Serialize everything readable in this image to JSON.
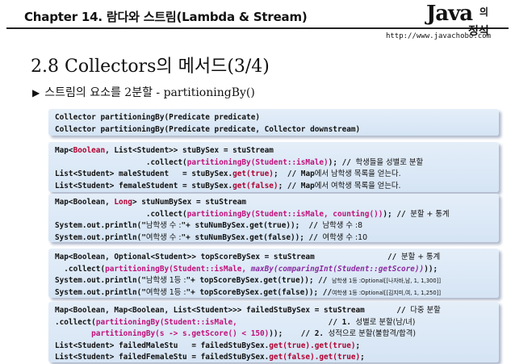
{
  "header": {
    "chapter_title": "Chapter 14. 람다와 스트림(Lambda & Stream)",
    "url": "http://www.javachobo.com",
    "logo_word": "Java",
    "logo_sub1": "의",
    "logo_sub2": "정석"
  },
  "slide": {
    "title": "2.8 Collectors의 메서드(3/4)",
    "bullet": "스트림의 요소를 2분할 - partitioningBy()"
  },
  "code": {
    "b1": {
      "l1": "Collector partitioningBy(Predicate predicate)",
      "l2": "Collector partitioningBy(Predicate predicate, Collector downstream)"
    },
    "b2": {
      "l1a": "Map<",
      "l1b": "Boolean",
      "l1c": ", List<Student>> stuBySex = stuStream",
      "l2a": "                    .collect(",
      "l2b": "partitioningBy(Student::isMale)",
      "l2c": "); // ",
      "l2d": "학생들을 성별로 분할",
      "l3a": "List<Student> maleStudent   = stuBySex.",
      "l3b": "get(true)",
      "l3c": ";  // Map",
      "l3d": "에서 남학생 목록을 얻는다.",
      "l4a": "List<Student> femaleStudent = stuBySex.",
      "l4b": "get(false)",
      "l4c": "; // Map",
      "l4d": "에서 여학생 목록을 얻는다."
    },
    "b3": {
      "l1a": "Map<Boolean, ",
      "l1b": "Long",
      "l1c": "> stuNumBySex = stuStream",
      "l2a": "                    .collect(",
      "l2b": "partitioningBy(Student::isMale, counting())",
      "l2c": "); // ",
      "l2d": "분할 + 통계",
      "l3a": "System.out.println(\"",
      "l3b": "남학생 수 :",
      "l3c": "\"+ stuNumBySex.get(true));  // ",
      "l3d": "남학생 수 :8",
      "l4a": "System.out.println(\"",
      "l4b": "여학생 수 :",
      "l4c": "\"+ stuNumBySex.get(false)); // ",
      "l4d": "여학생 수 :10"
    },
    "b4": {
      "l1a": "Map<Boolean, Optional<Student>> topScoreBySex = stuStream                // ",
      "l1b": "분할 + 통계",
      "l2a": "  .collect(",
      "l2b": "partitioningBy(Student::isMale, ",
      "l2c": "maxBy(comparingInt(Student::getScore))",
      "l2d": "));",
      "l3a": "System.out.println(\"",
      "l3b": "남학생 1등 :",
      "l3c": "\"+ topScoreBySex.get(true)); // ",
      "l3d": "남학생 1등 :Optional[[나자바,남, 1, 1,300]]",
      "l4a": "System.out.println(\"",
      "l4b": "여학생 1등 :",
      "l4c": "\"+ topScoreBySex.get(false)); //",
      "l4d": "여학생 1등 :Optional[[김지미,여, 1, 1,250]]"
    },
    "b5": {
      "l1a": "Map<Boolean, Map<Boolean, List<Student>>> failedStuBySex = stuStream       // ",
      "l1b": "다중 분할",
      "l2a": ".collect(",
      "l2b": "partitioningBy(Student::isMale,",
      "l2c": "                    // 1. ",
      "l2d": "성별로 분할(남/녀)",
      "l3a": "        ",
      "l3b": "partitioningBy(s -> s.getScore() < 150)",
      "l3c": "));    // 2. ",
      "l3d": "성적으로 분할(불합격/합격)",
      "l4a": "List<Student> failedMaleStu   = failedStuBySex.",
      "l4b": "get(true).get(true)",
      "l4c": ";",
      "l5a": "List<Student> failedFemaleStu = failedStuBySex.",
      "l5b": "get(false).get(true)",
      "l5c": ";"
    }
  }
}
